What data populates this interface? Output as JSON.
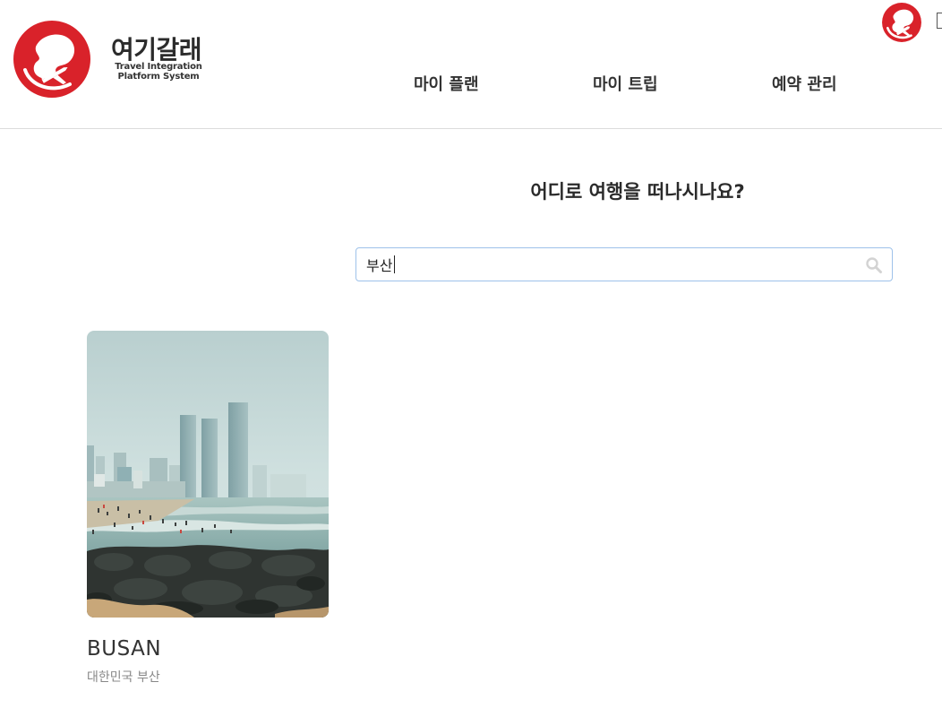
{
  "brand": {
    "name": "여기갈래",
    "subtitle_line1": "Travel Integration",
    "subtitle_line2": "Platform System",
    "color": "#d9222a"
  },
  "nav": {
    "items": [
      {
        "label": "마이 플랜"
      },
      {
        "label": "마이 트립"
      },
      {
        "label": "예약 관리"
      }
    ]
  },
  "main": {
    "heading": "어디로 여행을 떠나시나요?",
    "search": {
      "value": "부산",
      "placeholder": "",
      "border_color": "#9ec2ea"
    }
  },
  "results": [
    {
      "title": "BUSAN",
      "subtitle": "대한민국 부산",
      "image": "busan-beach-photo"
    }
  ],
  "icons": {
    "logo": "globe-airplane-logo-icon",
    "avatar": "globe-airplane-avatar-icon",
    "search": "search-icon"
  }
}
